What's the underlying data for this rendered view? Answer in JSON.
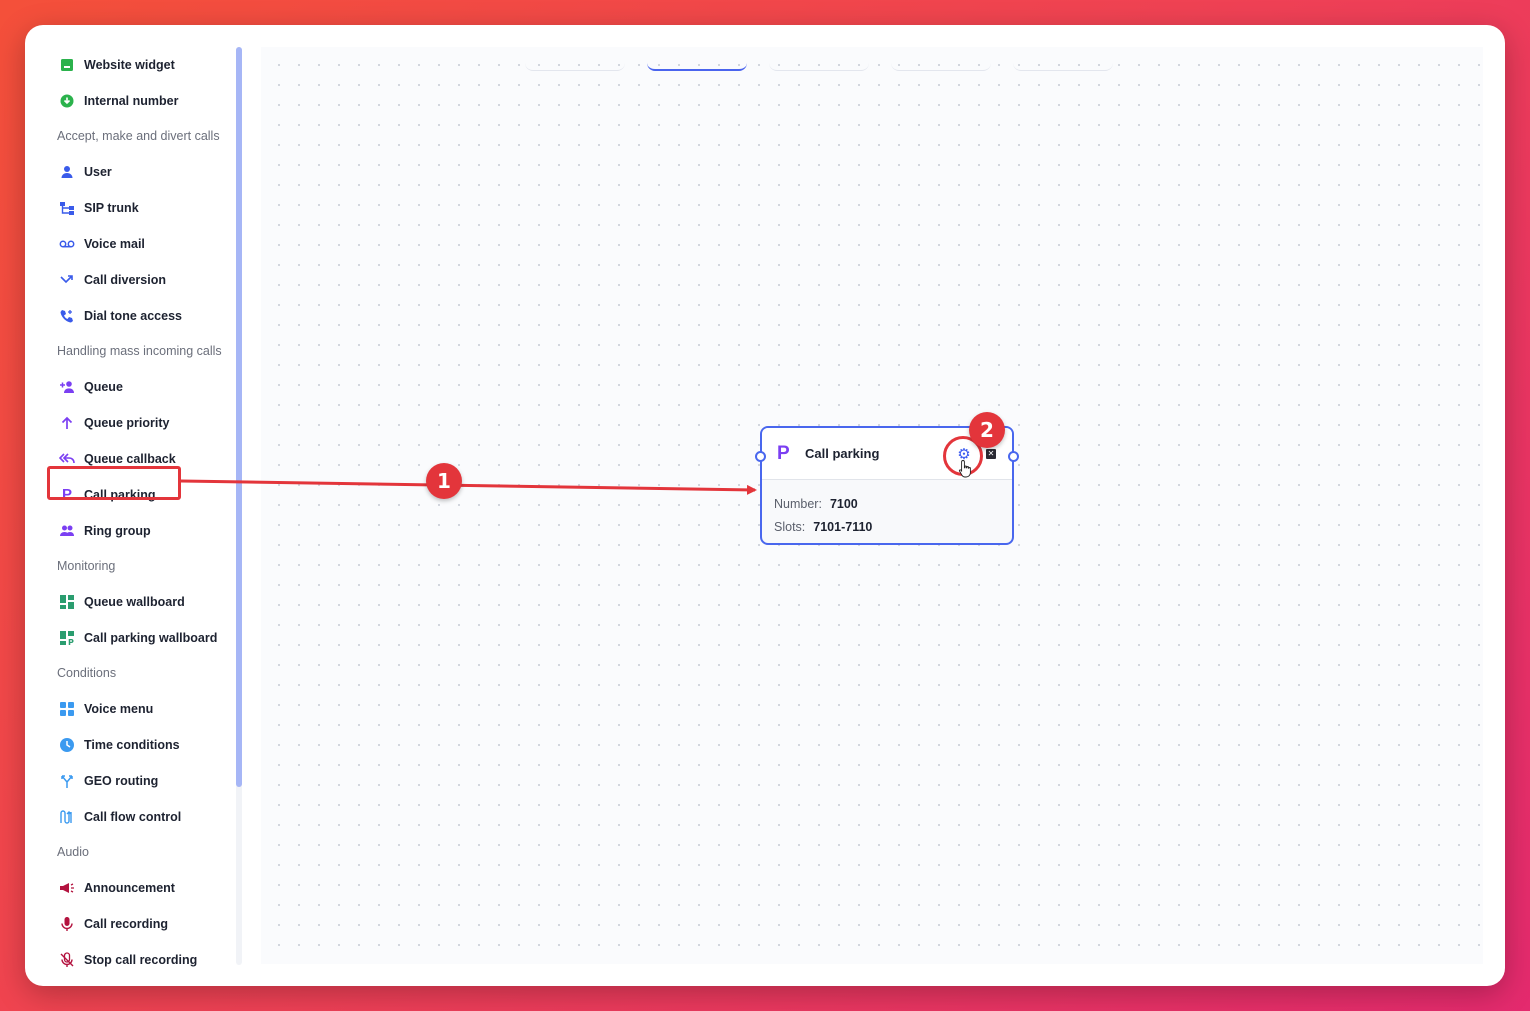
{
  "sidebar": {
    "top_items": [
      {
        "label": "Website widget",
        "icon": "website-widget-icon"
      },
      {
        "label": "Internal number",
        "icon": "internal-number-icon"
      }
    ],
    "sections": [
      {
        "title": "Accept, make and divert calls",
        "items": [
          {
            "label": "User",
            "icon": "user-icon"
          },
          {
            "label": "SIP trunk",
            "icon": "sip-trunk-icon"
          },
          {
            "label": "Voice mail",
            "icon": "voicemail-icon"
          },
          {
            "label": "Call diversion",
            "icon": "call-diversion-icon"
          },
          {
            "label": "Dial tone access",
            "icon": "dial-tone-icon"
          }
        ]
      },
      {
        "title": "Handling mass incoming calls",
        "items": [
          {
            "label": "Queue",
            "icon": "queue-icon"
          },
          {
            "label": "Queue priority",
            "icon": "arrow-up-icon"
          },
          {
            "label": "Queue callback",
            "icon": "reply-all-icon"
          },
          {
            "label": "Call parking",
            "icon": "parking-icon"
          },
          {
            "label": "Ring group",
            "icon": "group-icon"
          }
        ]
      },
      {
        "title": "Monitoring",
        "items": [
          {
            "label": "Queue wallboard",
            "icon": "wallboard-icon"
          },
          {
            "label": "Call parking wallboard",
            "icon": "parking-wallboard-icon"
          }
        ]
      },
      {
        "title": "Conditions",
        "items": [
          {
            "label": "Voice menu",
            "icon": "grid-icon"
          },
          {
            "label": "Time conditions",
            "icon": "clock-icon"
          },
          {
            "label": "GEO routing",
            "icon": "fork-icon"
          },
          {
            "label": "Call flow control",
            "icon": "flow-icon"
          }
        ]
      },
      {
        "title": "Audio",
        "items": [
          {
            "label": "Announcement",
            "icon": "megaphone-icon"
          },
          {
            "label": "Call recording",
            "icon": "microphone-icon"
          },
          {
            "label": "Stop call recording",
            "icon": "microphone-off-icon"
          }
        ]
      }
    ]
  },
  "node": {
    "title": "Call parking",
    "icon_glyph": "P",
    "number_label": "Number:",
    "number_value": "7100",
    "slots_label": "Slots:",
    "slots_value": "7101-7110",
    "gear_glyph": "⚙",
    "close_glyph": "✕"
  },
  "annotations": {
    "badge_1": "1",
    "badge_2": "2",
    "color": "#e3353b"
  },
  "colors": {
    "accent": "#4967ee",
    "parking": "#7b3ff2"
  }
}
